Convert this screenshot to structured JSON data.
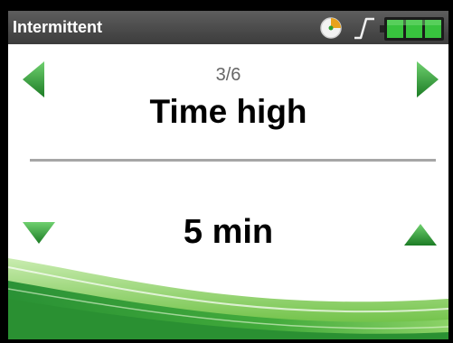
{
  "header": {
    "title": "Intermittent",
    "icons": [
      "pie-timer-icon",
      "step-signal-icon",
      "battery-icon"
    ]
  },
  "navigation": {
    "page_indicator": "3/6",
    "prev_icon": "triangle-left-icon",
    "next_icon": "triangle-right-icon"
  },
  "parameter": {
    "name": "Time high",
    "value": "5 min",
    "decrease_icon": "triangle-down-icon",
    "increase_icon": "triangle-up-icon"
  },
  "colors": {
    "titlebar": "#4a4a4a",
    "accent_green": "#2fa33a",
    "battery_green": "#38c23e",
    "divider": "#a6a6a6"
  }
}
